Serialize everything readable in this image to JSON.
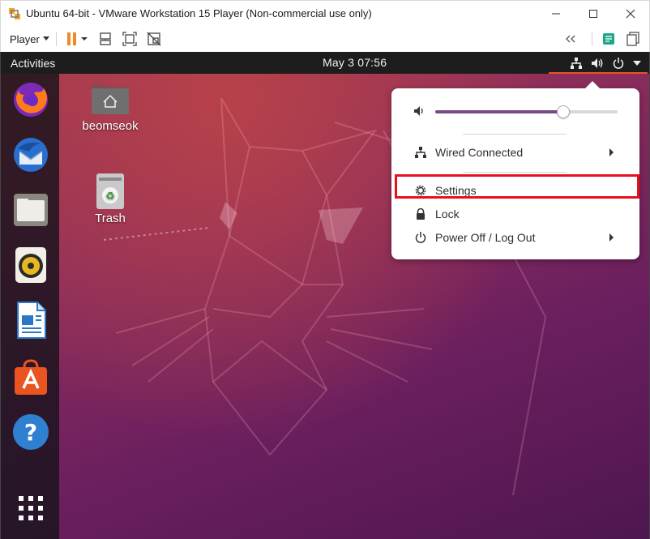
{
  "window": {
    "title": "Ubuntu 64-bit - VMware Workstation 15 Player (Non-commercial use only)"
  },
  "toolbar": {
    "player_label": "Player"
  },
  "ubuntu": {
    "activities": "Activities",
    "clock": "May 3  07:56",
    "accent_color": "#e95420"
  },
  "dock": {
    "items": [
      "firefox-icon",
      "thunderbird-icon",
      "files-icon",
      "rhythmbox-icon",
      "libreoffice-writer-icon",
      "software-center-icon",
      "help-icon",
      "show-apps-icon"
    ]
  },
  "desktop_icons": {
    "home_label": "beomseok",
    "trash_label": "Trash"
  },
  "system_menu": {
    "volume_level": 0.7,
    "wired_label": "Wired Connected",
    "settings_label": "Settings",
    "lock_label": "Lock",
    "power_label": "Power Off / Log Out"
  }
}
